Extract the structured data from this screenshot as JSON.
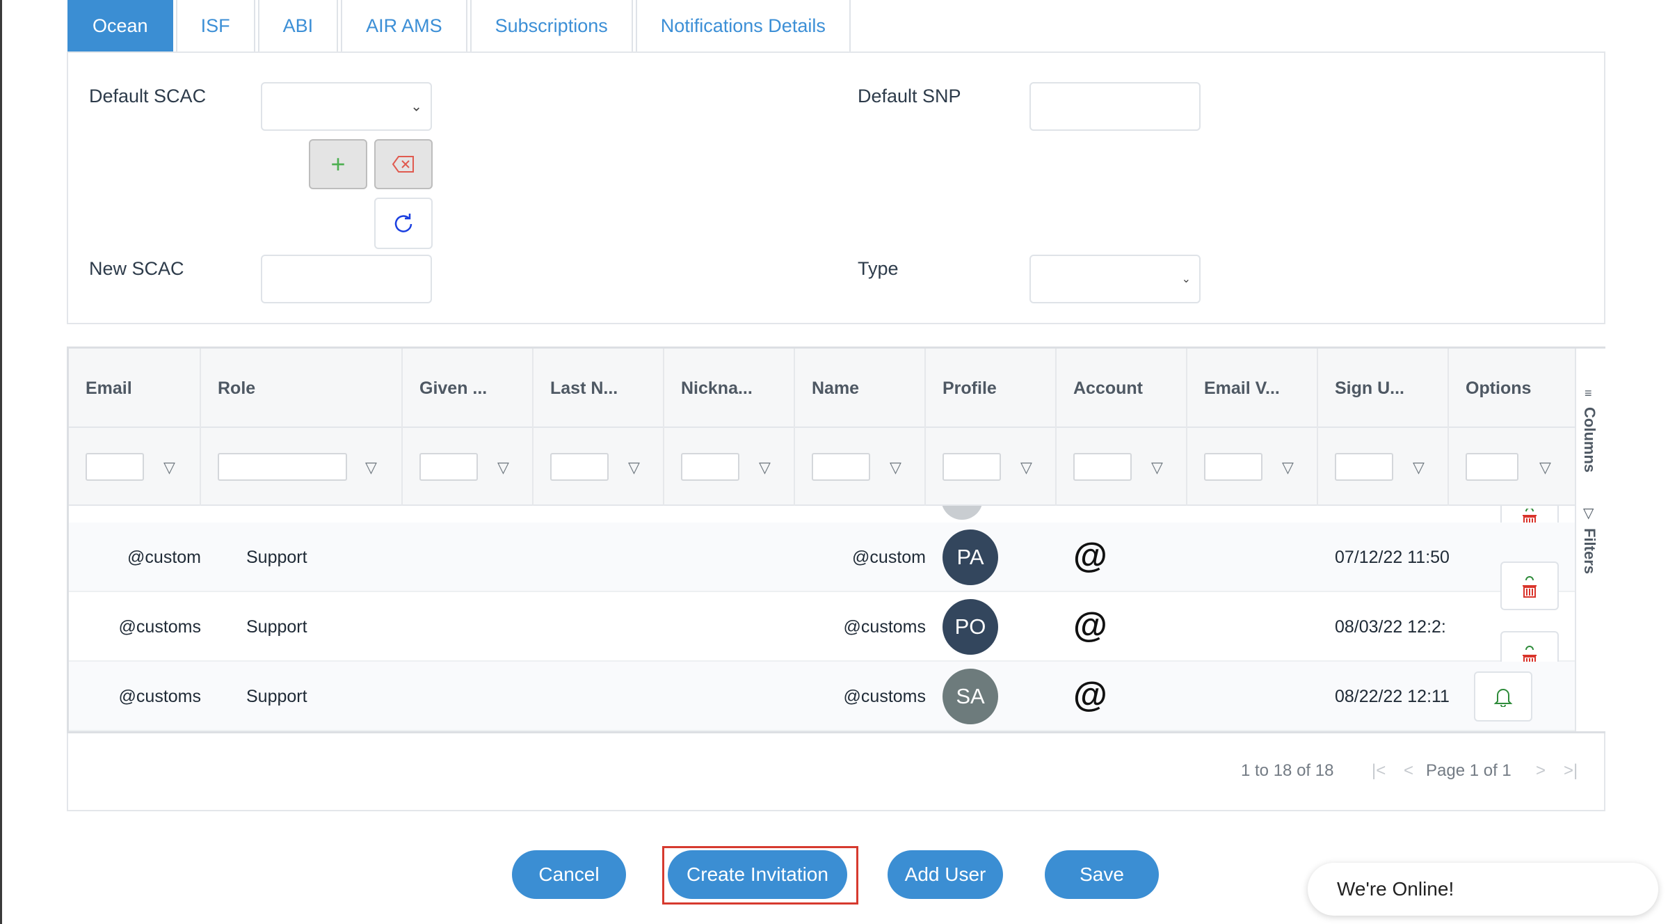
{
  "tabs": [
    "Ocean",
    "ISF",
    "ABI",
    "AIR AMS",
    "Subscriptions",
    "Notifications Details"
  ],
  "form": {
    "default_scac_label": "Default SCAC",
    "default_snp_label": "Default SNP",
    "new_scac_label": "New SCAC",
    "type_label": "Type"
  },
  "grid": {
    "columns": [
      "Email",
      "Role",
      "Given ...",
      "Last N...",
      "Nickna...",
      "Name",
      "Profile",
      "Account",
      "Email V...",
      "Sign U...",
      "Options"
    ],
    "side_tabs": [
      "Columns",
      "Filters"
    ],
    "rows": [
      {
        "email": "@custom",
        "role": "Support",
        "name": "@custom",
        "avatar": "PA",
        "avatar_color": "#33465d",
        "account_icon": "@",
        "signup": "07/12/22 11:50"
      },
      {
        "email": "@customs",
        "role": "Support",
        "name": "@customs",
        "avatar": "PO",
        "avatar_color": "#33465d",
        "account_icon": "@",
        "signup": "08/03/22 12:2:"
      },
      {
        "email": "@customs",
        "role": "Support",
        "name": "@customs",
        "avatar": "SA",
        "avatar_color": "#6d7b7c",
        "account_icon": "@",
        "signup": "08/22/22 12:11"
      }
    ],
    "pager": {
      "summary": "1 to 18 of 18",
      "page_text": "Page 1 of 1"
    }
  },
  "buttons": {
    "cancel": "Cancel",
    "create_invitation": "Create Invitation",
    "add_user": "Add User",
    "save": "Save"
  },
  "chat": {
    "label": "We're Online!"
  },
  "colors": {
    "accent": "#3b8ed3",
    "highlight": "#d63a2f"
  }
}
